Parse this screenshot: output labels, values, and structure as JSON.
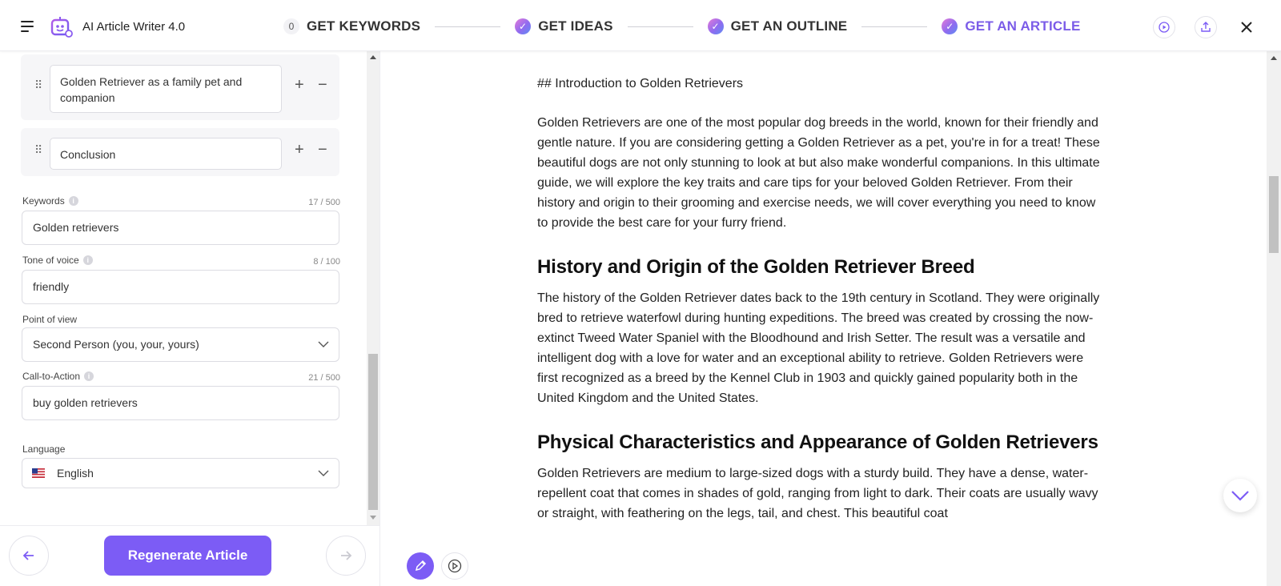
{
  "header": {
    "app_title": "AI Article Writer 4.0",
    "steps": [
      {
        "label": "GET KEYWORDS",
        "marker": "0"
      },
      {
        "label": "GET IDEAS"
      },
      {
        "label": "GET AN OUTLINE"
      },
      {
        "label": "GET AN ARTICLE"
      }
    ]
  },
  "outline": {
    "items": [
      {
        "text": "Golden Retriever as a family pet and companion"
      },
      {
        "text": "Conclusion"
      }
    ]
  },
  "form": {
    "keywords": {
      "label": "Keywords",
      "counter": "17 / 500",
      "value": "Golden retrievers"
    },
    "tone": {
      "label": "Tone of voice",
      "counter": "8 / 100",
      "value": "friendly"
    },
    "pov": {
      "label": "Point of view",
      "value": "Second Person (you, your, yours)"
    },
    "cta": {
      "label": "Call-to-Action",
      "counter": "21 / 500",
      "value": "buy golden retrievers"
    },
    "language": {
      "label": "Language",
      "value": "English"
    }
  },
  "footer": {
    "regenerate_label": "Regenerate Article"
  },
  "article": {
    "md_heading": "## Introduction to Golden Retrievers",
    "intro": "Golden Retrievers are one of the most popular dog breeds in the world, known for their friendly and gentle nature. If you are considering getting a Golden Retriever as a pet, you're in for a treat! These beautiful dogs are not only stunning to look at but also make wonderful companions. In this ultimate guide, we will explore the key traits and care tips for your beloved Golden Retriever. From their history and origin to their grooming and exercise needs, we will cover everything you need to know to provide the best care for your furry friend.",
    "h2_history": "History and Origin of the Golden Retriever Breed",
    "history": "The history of the Golden Retriever dates back to the 19th century in Scotland. They were originally bred to retrieve waterfowl during hunting expeditions. The breed was created by crossing the now-extinct Tweed Water Spaniel with the Bloodhound and Irish Setter. The result was a versatile and intelligent dog with a love for water and an exceptional ability to retrieve. Golden Retrievers were first recognized as a breed by the Kennel Club in 1903 and quickly gained popularity both in the United Kingdom and the United States.",
    "h2_physical": "Physical Characteristics and Appearance of Golden Retrievers",
    "physical": "Golden Retrievers are medium to large-sized dogs with a sturdy build. They have a dense, water-repellent coat that comes in shades of gold, ranging from light to dark. Their coats are usually wavy or straight, with feathering on the legs, tail, and chest. This beautiful coat"
  },
  "colors": {
    "accent": "#7c5cf5",
    "active_step": "#7b5ce8"
  },
  "icons": [
    "menu-icon",
    "robot-logo-icon",
    "check-icon",
    "play-icon",
    "share-icon",
    "close-icon",
    "drag-icon",
    "plus-icon",
    "minus-icon",
    "info-icon",
    "chevron-down-icon",
    "us-flag-icon",
    "arrow-left-icon",
    "arrow-right-icon",
    "pencil-icon"
  ]
}
